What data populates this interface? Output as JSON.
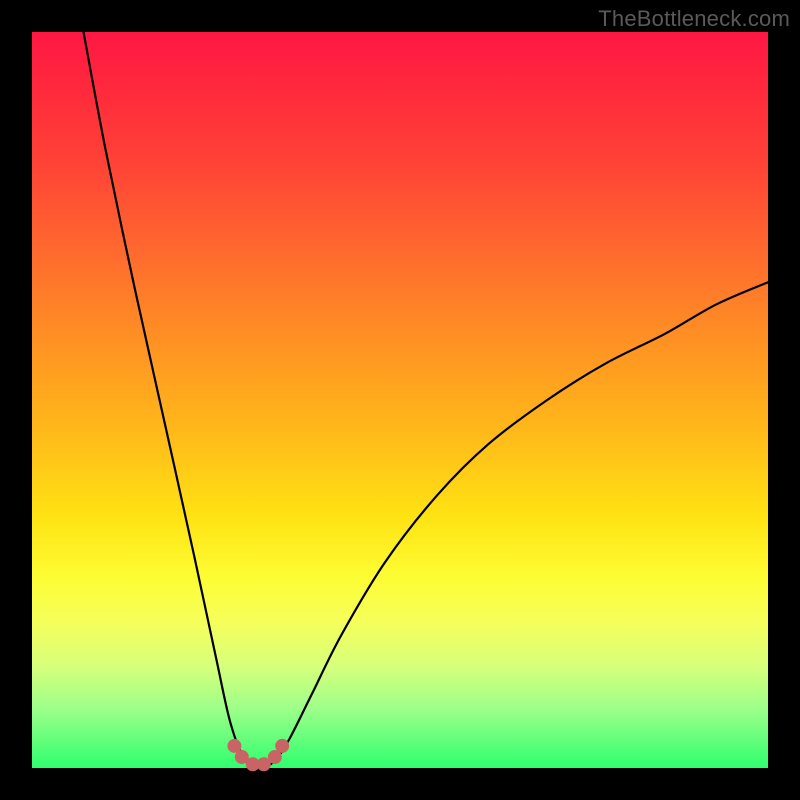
{
  "watermark": "TheBottleneck.com",
  "colors": {
    "frame": "#000000",
    "curve_stroke": "#000000",
    "dot_fill": "#c96464",
    "gradient_top": "#ff1744",
    "gradient_bottom": "#2eff6e"
  },
  "chart_data": {
    "type": "line",
    "title": "",
    "xlabel": "",
    "ylabel": "",
    "xlim": [
      0,
      100
    ],
    "ylim": [
      0,
      100
    ],
    "description": "V-shaped bottleneck curve plotted over a vertical red-to-green gradient. The curve descends steeply from upper-left, reaches a flat minimum near x≈28–34 at y≈0, then rises to the right approaching y≈66 at x=100. A short cluster of salmon-colored dots marks the trough.",
    "series": [
      {
        "name": "bottleneck-curve",
        "x": [
          7,
          10,
          14,
          18,
          22,
          25,
          27,
          29,
          31,
          33,
          35,
          38,
          42,
          48,
          55,
          62,
          70,
          78,
          86,
          93,
          100
        ],
        "y": [
          100,
          84,
          65,
          47,
          29,
          15,
          6,
          1,
          0,
          1,
          4,
          10,
          18,
          28,
          37,
          44,
          50,
          55,
          59,
          63,
          66
        ]
      }
    ],
    "trough_points": {
      "x": [
        27.5,
        28.5,
        30,
        31.5,
        33,
        34
      ],
      "y": [
        3,
        1.5,
        0.5,
        0.5,
        1.5,
        3
      ]
    }
  }
}
